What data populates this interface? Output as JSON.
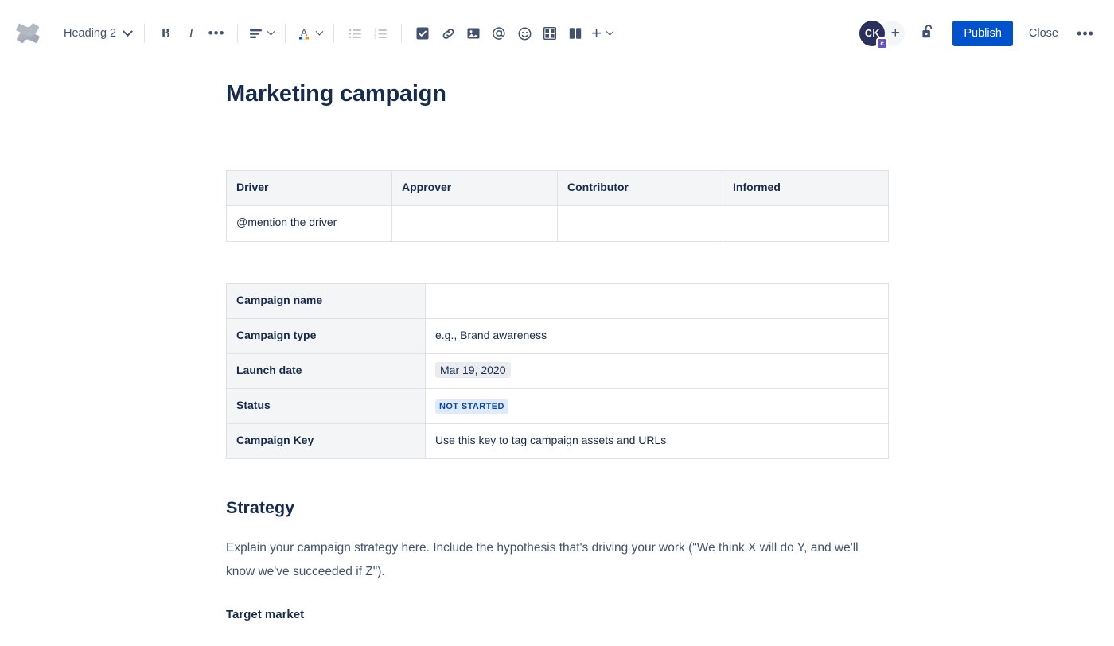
{
  "app": {
    "logo_icon": "confluence-logo-icon"
  },
  "toolbar": {
    "block_type": "Heading 2",
    "items": [
      {
        "name": "bold-button",
        "label": "B",
        "icon": "bold-icon"
      },
      {
        "name": "italic-button",
        "label": "I",
        "icon": "italic-icon"
      },
      {
        "name": "more-formatting-button",
        "label": "•••",
        "icon": "ellipsis-icon"
      },
      {
        "name": "text-alignment-button",
        "label": "",
        "icon": "align-left-icon"
      },
      {
        "name": "text-color-button",
        "label": "A",
        "icon": "text-color-icon"
      },
      {
        "name": "bullet-list-button",
        "label": "",
        "icon": "bullet-list-icon"
      },
      {
        "name": "numbered-list-button",
        "label": "",
        "icon": "numbered-list-icon"
      },
      {
        "name": "action-item-button",
        "label": "",
        "icon": "task-checkbox-icon"
      },
      {
        "name": "link-button",
        "label": "",
        "icon": "link-icon"
      },
      {
        "name": "image-button",
        "label": "",
        "icon": "image-icon"
      },
      {
        "name": "mention-button",
        "label": "@",
        "icon": "mention-icon"
      },
      {
        "name": "emoji-button",
        "label": "",
        "icon": "emoji-icon"
      },
      {
        "name": "table-button",
        "label": "",
        "icon": "table-icon"
      },
      {
        "name": "layout-button",
        "label": "",
        "icon": "layout-columns-icon"
      },
      {
        "name": "insert-more-button",
        "label": "+",
        "icon": "plus-icon"
      }
    ],
    "avatar_initials": "CK",
    "avatar_badge": "c",
    "add_person_label": "+",
    "restrictions_icon": "unlocked-padlock-icon",
    "publish_label": "Publish",
    "close_label": "Close",
    "more_label": "•••"
  },
  "colors": {
    "accent_blue": "#0052cc",
    "avatar_bg": "#2b2f5b",
    "badge_purple": "#6554c0",
    "lozenge_bg": "#deebff",
    "lozenge_text": "#0747a6",
    "table_header_bg": "#f4f5f7",
    "table_border": "#dfe1e6",
    "text_primary": "#172b4d",
    "text_secondary": "#42526e",
    "placeholder": "#7a869a"
  },
  "page": {
    "title": "Marketing campaign"
  },
  "daci_table": {
    "headers": [
      "Driver",
      "Approver",
      "Contributor",
      "Informed"
    ],
    "rows": [
      [
        "@mention the driver",
        "",
        "",
        ""
      ]
    ]
  },
  "detail_table": {
    "rows": [
      {
        "label": "Campaign name",
        "value": "",
        "type": "text"
      },
      {
        "label": "Campaign type",
        "value": "e.g., Brand awareness",
        "type": "placeholder"
      },
      {
        "label": "Launch date",
        "value": "Mar 19, 2020",
        "type": "date"
      },
      {
        "label": "Status",
        "value": "NOT STARTED",
        "type": "lozenge"
      },
      {
        "label": "Campaign Key",
        "value": "Use this key to tag campaign assets and URLs",
        "type": "placeholder"
      }
    ]
  },
  "strategy": {
    "heading": "Strategy",
    "paragraph": "Explain your campaign strategy here. Include the hypothesis that's driving your work (\"We think X will do Y, and we'll know we've succeeded if Z\").",
    "sub_heading": "Target market"
  }
}
